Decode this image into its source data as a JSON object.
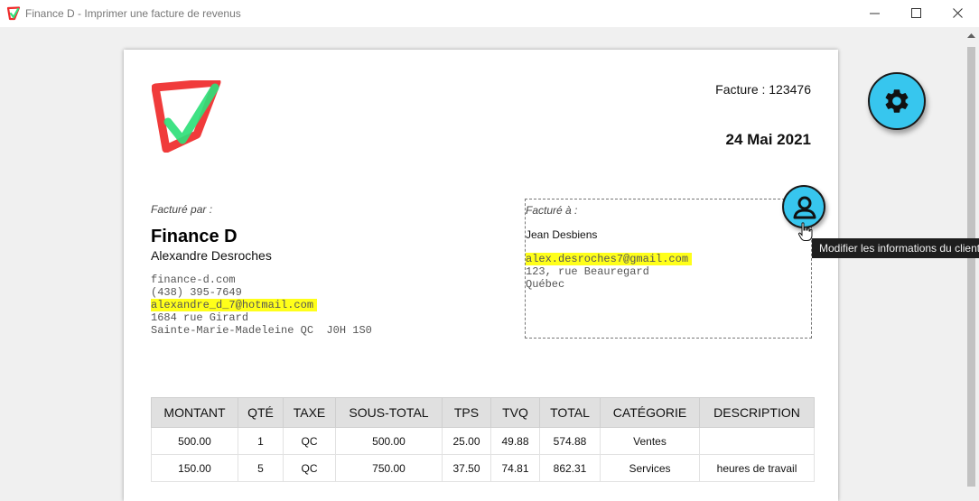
{
  "window": {
    "title": "Finance D - Imprimer une facture de revenus"
  },
  "invoice": {
    "number_text": "Facture : 123476",
    "date": "24 Mai 2021"
  },
  "billed_by": {
    "label": "Facturé par :",
    "company": "Finance D",
    "person": "Alexandre Desroches",
    "website": "finance-d.com",
    "phone": "(438) 395-7649",
    "email": "alexandre_d_7@hotmail.com",
    "address_line1": "1684 rue Girard",
    "address_line2": "Sainte-Marie-Madeleine QC  J0H 1S0"
  },
  "billed_to": {
    "label": "Facturé à :",
    "name": "Jean Desbiens",
    "email": "alex.desroches7@gmail.com",
    "address_line1": "123, rue Beauregard",
    "address_line2": "Québec"
  },
  "table": {
    "headers": [
      "MONTANT",
      "QTÉ",
      "TAXE",
      "SOUS-TOTAL",
      "TPS",
      "TVQ",
      "TOTAL",
      "CATÉGORIE",
      "DESCRIPTION"
    ],
    "rows": [
      [
        "500.00",
        "1",
        "QC",
        "500.00",
        "25.00",
        "49.88",
        "574.88",
        "Ventes",
        ""
      ],
      [
        "150.00",
        "5",
        "QC",
        "750.00",
        "37.50",
        "74.81",
        "862.31",
        "Services",
        "heures de travail"
      ]
    ]
  },
  "tooltip": {
    "text": "Modifier les informations du client"
  },
  "icons": {
    "settings": "gear-icon",
    "edit_client": "user-icon",
    "cursor": "hand-pointer-icon"
  },
  "colors": {
    "accent": "#37c6ee",
    "highlight": "#ffff1a",
    "logo_red": "#ef2a2a",
    "logo_green": "#2fe07a"
  }
}
